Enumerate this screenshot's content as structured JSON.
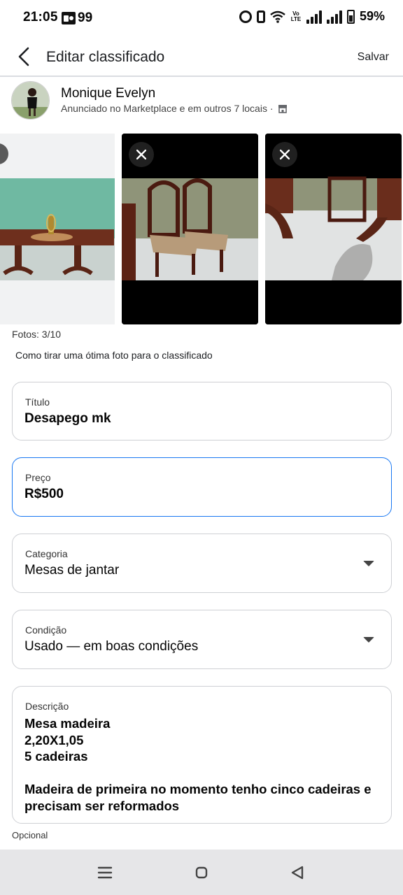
{
  "status_bar": {
    "time": "21:05",
    "notification_count": "99",
    "battery_percent": "59%"
  },
  "header": {
    "title": "Editar classificado",
    "save_label": "Salvar"
  },
  "seller": {
    "name": "Monique Evelyn",
    "subtitle": "Anunciado no Marketplace e em outros 7 locais ·"
  },
  "photos": {
    "count_label": "Fotos: 3/10",
    "tip_link": "Como tirar uma ótima foto para o classificado"
  },
  "fields": {
    "title": {
      "label": "Título",
      "value": "Desapego mk"
    },
    "price": {
      "label": "Preço",
      "value": "R$500"
    },
    "category": {
      "label": "Categoria",
      "value": "Mesas de jantar"
    },
    "condition": {
      "label": "Condição",
      "value": "Usado — em boas condições"
    },
    "description": {
      "label": "Descrição",
      "lines": [
        "Mesa madeira",
        "2,20X1,05",
        "5 cadeiras",
        "",
        "Madeira de primeira no momento tenho cinco cadeiras e precisam ser reformados"
      ]
    }
  },
  "optional_note": "Opcional",
  "colors": {
    "accent_focus": "#1877f2",
    "field_border": "#ced0d4",
    "nav_bar": "#e6e6e8"
  }
}
